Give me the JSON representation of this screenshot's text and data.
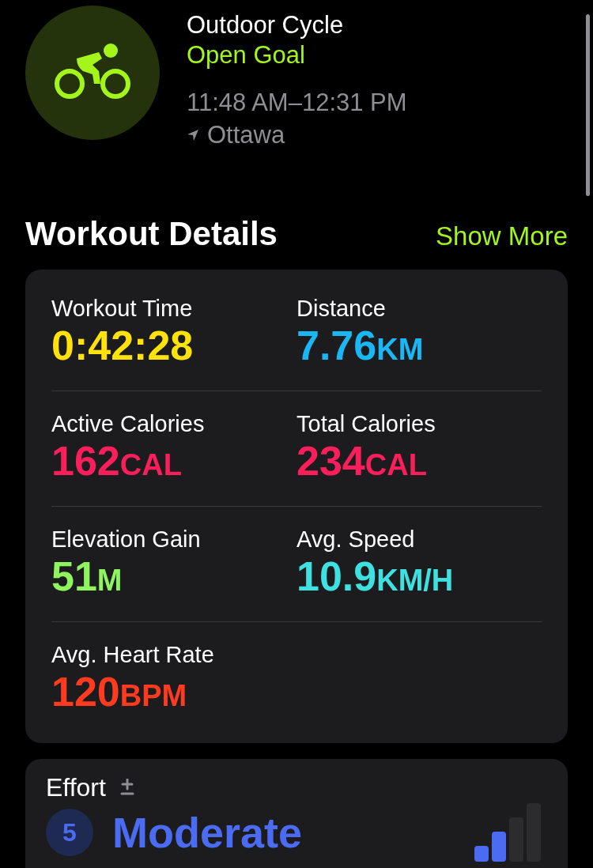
{
  "workout": {
    "title": "Outdoor Cycle",
    "goal": "Open Goal",
    "time": "11:48 AM–12:31 PM",
    "location": "Ottawa"
  },
  "details": {
    "title": "Workout Details",
    "action": "Show More",
    "metrics": [
      {
        "label": "Workout Time",
        "value": "0:42:28",
        "color": "#ffe20a"
      },
      {
        "label": "Distance",
        "value": "7.76",
        "unit": "KM",
        "color": "#19b8f5"
      },
      {
        "label": "Active Calories",
        "value": "162",
        "unit": "CAL",
        "color": "#fa1f5a"
      },
      {
        "label": "Total Calories",
        "value": "234",
        "unit": "CAL",
        "color": "#fa1f5a"
      },
      {
        "label": "Elevation Gain",
        "value": "51",
        "unit": "M",
        "color": "#8ef55e"
      },
      {
        "label": "Avg. Speed",
        "value": "10.9",
        "unit": "KM/H",
        "color": "#3ee0e0"
      },
      {
        "label": "Avg. Heart Rate",
        "value": "120",
        "unit": "BPM",
        "color": "#ff3b1f"
      }
    ]
  },
  "effort": {
    "title": "Effort",
    "score": "5",
    "rating": "Moderate",
    "level": 0.5
  }
}
